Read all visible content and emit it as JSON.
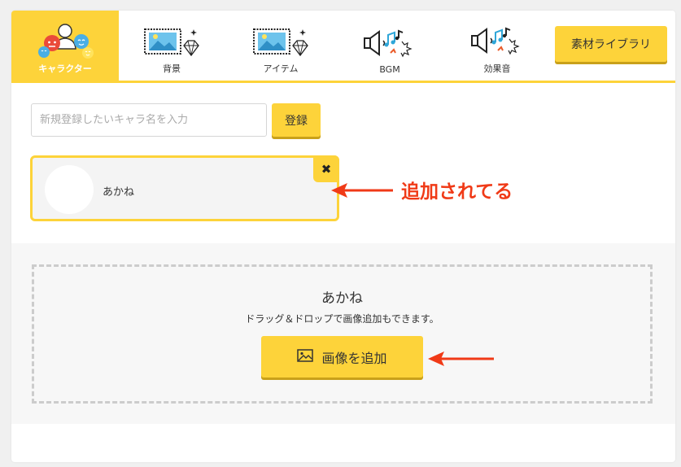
{
  "tabs": [
    {
      "label": "キャラクター",
      "icon": "characters-icon",
      "active": true
    },
    {
      "label": "背景",
      "icon": "background-image-icon",
      "active": false
    },
    {
      "label": "アイテム",
      "icon": "item-image-icon",
      "active": false
    },
    {
      "label": "BGM",
      "icon": "bgm-speaker-icon",
      "active": false
    },
    {
      "label": "効果音",
      "icon": "sound-effect-speaker-icon",
      "active": false
    }
  ],
  "library_button": "素材ライブラリ",
  "register": {
    "placeholder": "新規登録したいキャラ名を入力",
    "button": "登録"
  },
  "character": {
    "name": "あかね",
    "delete_label": "✖"
  },
  "drop_area": {
    "title": "あかね",
    "hint": "ドラッグ＆ドロップで画像追加もできます。",
    "add_button": "画像を追加"
  },
  "annotation": {
    "text": "追加されてる",
    "color": "#f03a17"
  },
  "colors": {
    "accent": "#fdd33a",
    "accent_shadow": "#c9a11a"
  }
}
